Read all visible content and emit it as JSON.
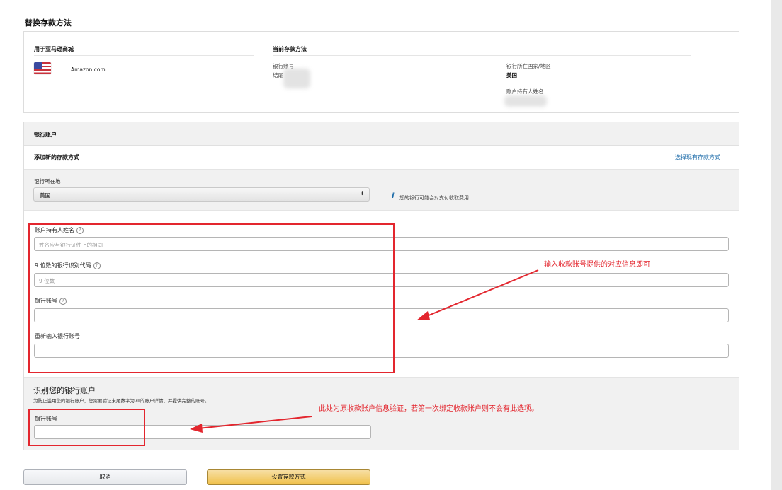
{
  "page": {
    "title": "替换存款方法"
  },
  "current": {
    "marketplace_label": "用于亚马逊商城",
    "marketplace_name": "Amazon.com",
    "method_label": "当前存款方法",
    "account_label": "银行账号",
    "account_ending": "结尾",
    "country_label": "银行所在国家/地区",
    "country_value": "美国",
    "holder_label": "账户持有人姓名"
  },
  "bank": {
    "header": "银行账户",
    "add_label": "添加新的存款方式",
    "choose_existing_link": "选择现有存款方式",
    "location_label": "银行所在地",
    "location_value": "美国",
    "location_info": "您的银行可能会对支付收取费用",
    "fields": [
      {
        "label": "账户持有人姓名",
        "placeholder": "姓名应与银行证件上的相同"
      },
      {
        "label": "9 位数的银行识别代码",
        "placeholder": "9 位数"
      },
      {
        "label": "银行账号",
        "placeholder": ""
      },
      {
        "label": "重新输入银行账号",
        "placeholder": ""
      }
    ]
  },
  "verify": {
    "title": "识别您的银行账户",
    "desc": "为防止滥用您的银行账户，您需要验证末尾数字为7II的账户详情，并提供完整的账号。",
    "field_label": "银行账号"
  },
  "annotations": {
    "note1": "输入收款账号提供的对应信息即可",
    "note2": "此处为原收款账户信息验证，若第一次绑定收款账户则不会有此选项。",
    "color": "#e3262e"
  },
  "buttons": {
    "cancel": "取消",
    "submit": "设置存款方式"
  }
}
